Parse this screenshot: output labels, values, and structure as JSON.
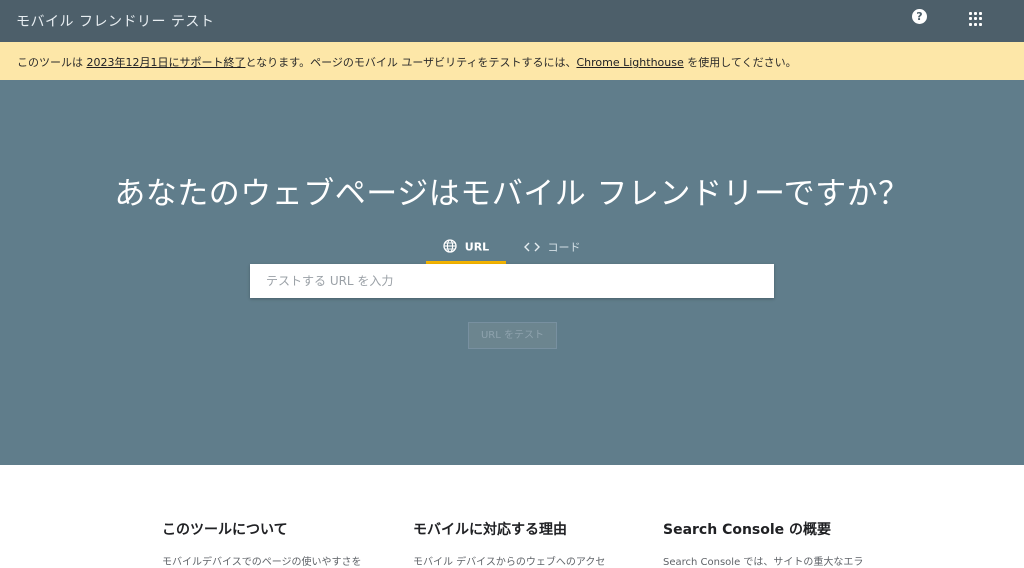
{
  "header": {
    "title": "モバイル フレンドリー テスト",
    "help_icon": "help-icon",
    "apps_icon": "apps-grid-icon",
    "help_symbol": "?"
  },
  "notice": {
    "prefix": "このツールは ",
    "date_link": "2023年12月1日にサポート終了",
    "middle": "となります。ページのモバイル ユーザビリティをテストするには、",
    "lighthouse_link": "Chrome Lighthouse",
    "suffix": " を使用してください。"
  },
  "hero": {
    "heading": "あなたのウェブページはモバイル フレンドリーですか？",
    "tabs": [
      {
        "label": "URL",
        "icon": "globe-icon",
        "selected": true
      },
      {
        "label": "コード",
        "icon": "code-icon",
        "selected": false
      }
    ],
    "input_placeholder": "テストする URL を入力",
    "test_button": "URL をテスト"
  },
  "info": {
    "columns": [
      {
        "title": "このツールについて",
        "text": "モバイルデバイスでのページの使いやすさを"
      },
      {
        "title": "モバイルに対応する理由",
        "text": "モバイル デバイスからのウェブへのアクセ"
      },
      {
        "title": "Search Console の概要",
        "text": "Search Console では、サイトの重大なエラ"
      }
    ]
  },
  "colors": {
    "topbar": "#4d5f6a",
    "notice_bg": "#fde7a8",
    "hero_bg": "#607d8b",
    "tab_accent": "#f4b400"
  }
}
